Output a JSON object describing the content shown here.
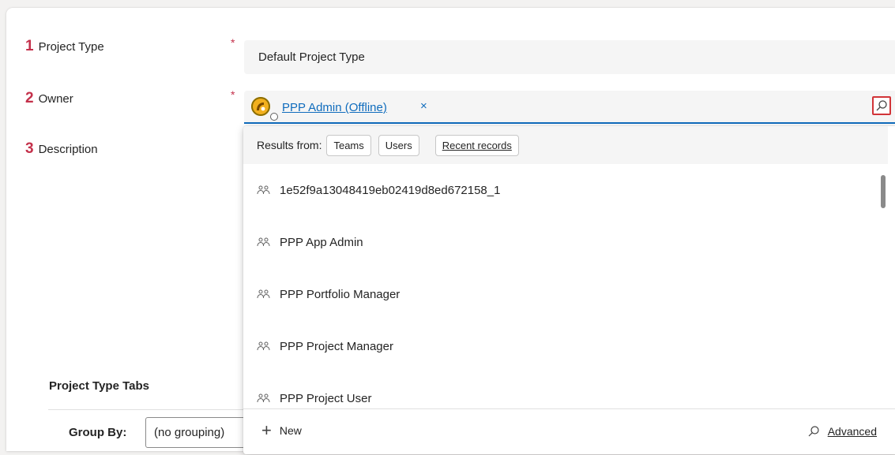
{
  "fields": [
    {
      "number": "1",
      "label": "Project Type"
    },
    {
      "number": "2",
      "label": "Owner"
    },
    {
      "number": "3",
      "label": "Description"
    }
  ],
  "required_marker": "*",
  "project_type": {
    "value": "Default Project Type"
  },
  "owner": {
    "value": "PPP Admin (Offline)",
    "remove_glyph": "×"
  },
  "lookup": {
    "results_label": "Results from:",
    "filters": [
      "Teams",
      "Users",
      "Recent records"
    ],
    "items": [
      {
        "label": "1e52f9a13048419eb02419d8ed672158_1",
        "icon": "team-icon"
      },
      {
        "label": "PPP App Admin",
        "icon": "team-icon"
      },
      {
        "label": "PPP Portfolio Manager",
        "icon": "team-icon"
      },
      {
        "label": "PPP Project Manager",
        "icon": "team-icon"
      },
      {
        "label": "PPP Project User",
        "icon": "team-icon"
      }
    ],
    "new_label": "New",
    "advanced_label": "Advanced"
  },
  "tabs_section": {
    "title": "Project Type Tabs",
    "group_by_label": "Group By:",
    "group_by_value": "(no grouping)"
  },
  "colors": {
    "accent": "#0f6cbd",
    "required": "#c4314b",
    "highlight_box": "#d13438"
  }
}
